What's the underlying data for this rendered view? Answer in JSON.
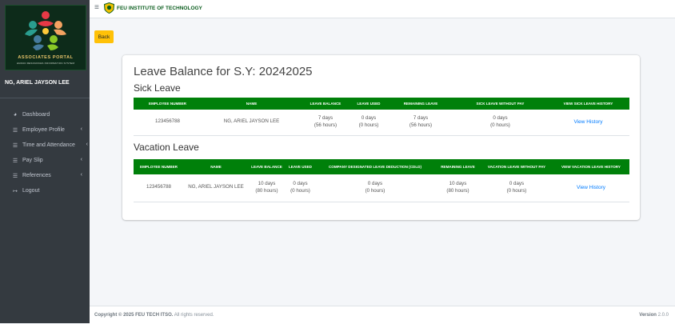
{
  "sidebar": {
    "brand_title": "ASSOCIATES PORTAL",
    "brand_subtitle": "HUMAN RESOURCES INFORMATION SYSTEM",
    "user_name": "NG, ARIEL JAYSON LEE",
    "items": [
      {
        "label": "Dashboard",
        "icon": "dashboard-icon"
      },
      {
        "label": "Employee Profile",
        "icon": "list-icon"
      },
      {
        "label": "Time and Attendance",
        "icon": "list-icon"
      },
      {
        "label": "Pay Slip",
        "icon": "list-icon"
      },
      {
        "label": "References",
        "icon": "list-icon"
      },
      {
        "label": "Logout",
        "icon": "logout-icon"
      }
    ]
  },
  "topbar": {
    "title": "FEU INSTITUTE OF TECHNOLOGY"
  },
  "back_label": "Back",
  "page_title": "Leave Balance for S.Y: 20242025",
  "sick": {
    "title": "Sick Leave",
    "headers": [
      "EMPLOYEE NUMBER",
      "NAME",
      "LEAVE BALANCE",
      "LEAVE USED",
      "REMAINING LEAVE",
      "SICK LEAVE WITHOUT PAY",
      "VIEW SICK LEAVE HISTORY"
    ],
    "row": {
      "employee_number": "123456788",
      "name": "NG, ARIEL JAYSON LEE",
      "balance_days": "7 days",
      "balance_hours": "(56 hours)",
      "used_days": "0 days",
      "used_hours": "(0 hours)",
      "remaining_days": "7 days",
      "remaining_hours": "(56 hours)",
      "without_pay_days": "0 days",
      "without_pay_hours": "(0 hours)",
      "history_link": "View History"
    }
  },
  "vacation": {
    "title": "Vacation Leave",
    "headers": [
      "EMPLOYEE NUMBER",
      "NAME",
      "LEAVE BALANCE",
      "LEAVE USED",
      "COMPANY DESIGNATED LEAVE DEDUCTION (CDLD)",
      "REMAINING LEAVE",
      "VACATION LEAVE WITHOUT PAY",
      "VIEW VACATION LEAVE HISTORY"
    ],
    "row": {
      "employee_number": "123456788",
      "name": "NG, ARIEL JAYSON LEE",
      "balance_days": "10 days",
      "balance_hours": "(80 hours)",
      "used_days": "0 days",
      "used_hours": "(0 hours)",
      "cdld_days": "0 days",
      "cdld_hours": "(0 hours)",
      "remaining_days": "10 days",
      "remaining_hours": "(80 hours)",
      "without_pay_days": "0 days",
      "without_pay_hours": "(0 hours)",
      "history_link": "View History"
    }
  },
  "footer": {
    "copyright_bold": "Copyright © 2025 FEU TECH ITSO.",
    "copyright_rest": " All rights reserved.",
    "version_label": "Version",
    "version_number": " 2.0.0"
  },
  "colors": {
    "sidebar_bg": "#343a40",
    "header_green": "#00800a",
    "back_yellow": "#ffc107",
    "link_blue": "#007bff"
  }
}
